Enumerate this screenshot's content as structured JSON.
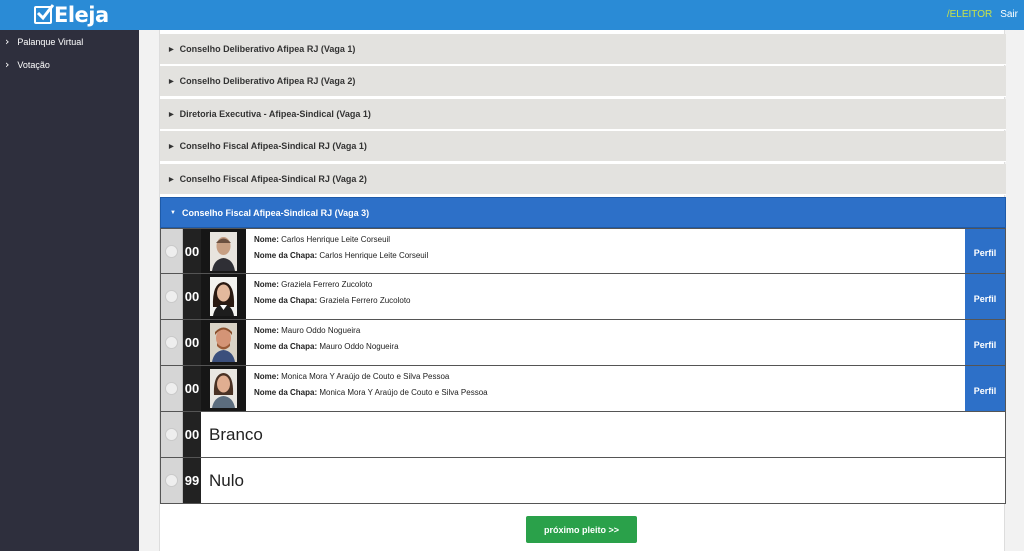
{
  "header": {
    "logo_text": "Eleja",
    "user_label": "/ELEITOR",
    "logout_label": "Sair"
  },
  "sidebar": {
    "items": [
      {
        "label": "Palanque Virtual",
        "icon": "chevron-right-icon"
      },
      {
        "label": "Votação",
        "icon": "chevron-right-icon"
      }
    ]
  },
  "accordion": [
    {
      "label": "Conselho Deliberativo Afipea RJ (Vaga 1)",
      "expanded": false
    },
    {
      "label": "Conselho Deliberativo Afipea RJ (Vaga 2)",
      "expanded": false
    },
    {
      "label": "Diretoria Executiva - Afipea-Sindical (Vaga 1)",
      "expanded": false
    },
    {
      "label": "Conselho Fiscal Afipea-Sindical RJ (Vaga 1)",
      "expanded": false
    },
    {
      "label": "Conselho Fiscal Afipea-Sindical RJ (Vaga 2)",
      "expanded": false
    },
    {
      "label": "Conselho Fiscal Afipea-Sindical RJ (Vaga 3)",
      "expanded": true
    }
  ],
  "labels": {
    "name": "Nome:",
    "slate": "Nome da Chapa:",
    "profile": "Perfil"
  },
  "candidates": [
    {
      "number": "00",
      "name": "Carlos Henrique Leite Corseuil",
      "slate": "Carlos Henrique Leite Corseuil"
    },
    {
      "number": "00",
      "name": "Graziela Ferrero Zucoloto",
      "slate": "Graziela Ferrero Zucoloto"
    },
    {
      "number": "00",
      "name": "Mauro Oddo Nogueira",
      "slate": "Mauro Oddo Nogueira"
    },
    {
      "number": "00",
      "name": "Monica Mora Y Araújo de Couto e Silva Pessoa",
      "slate": "Monica Mora Y Araújo de Couto e Silva Pessoa"
    }
  ],
  "special_options": [
    {
      "number": "00",
      "label": "Branco"
    },
    {
      "number": "99",
      "label": "Nulo"
    }
  ],
  "next_button_label": "próximo pleito >>",
  "colors": {
    "topbar": "#2a8bd6",
    "sidebar": "#2e2f3d",
    "active_accordion": "#2d70c8",
    "next_button": "#2aa14a",
    "user_label": "#c8e24a"
  }
}
